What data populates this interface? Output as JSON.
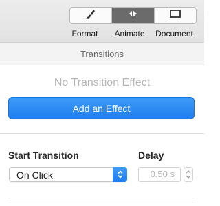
{
  "toolbar": {
    "tabs": [
      {
        "label": "Format",
        "icon": "paintbrush-icon"
      },
      {
        "label": "Animate",
        "icon": "diamond-arrows-icon"
      },
      {
        "label": "Document",
        "icon": "document-rect-icon"
      }
    ],
    "active_tab": "Animate"
  },
  "transitions": {
    "header": "Transitions",
    "empty_text": "No Transition Effect",
    "add_button": "Add an Effect"
  },
  "start_transition": {
    "label": "Start Transition",
    "value": "On Click"
  },
  "delay": {
    "label": "Delay",
    "value": "0.50 s"
  },
  "colors": {
    "accent": "#1f7ef0",
    "active_segment": "#6b6b6b",
    "disabled_text": "#b6b6b6"
  }
}
